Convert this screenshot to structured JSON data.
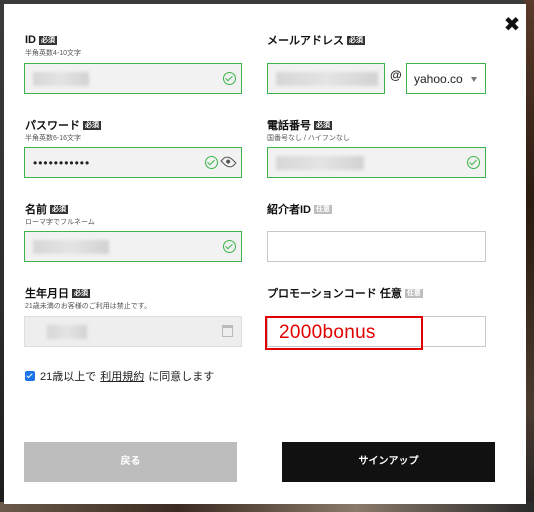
{
  "close_label": "✖",
  "fields": {
    "id": {
      "label": "ID",
      "badge": "必須",
      "hint": "半角英数4-10文字"
    },
    "email": {
      "label": "メールアドレス",
      "badge": "必須",
      "at": "@",
      "domain_selected": "yahoo.co"
    },
    "password": {
      "label": "パスワード",
      "badge": "必須",
      "hint": "半角英数6-16文字",
      "value": "•••••••••••"
    },
    "phone": {
      "label": "電話番号",
      "badge": "必須",
      "hint": "国番号なし / ハイフンなし"
    },
    "name": {
      "label": "名前",
      "badge": "必須",
      "hint": "ローマ字でフルネーム"
    },
    "referrer": {
      "label": "紹介者ID",
      "badge": "任意"
    },
    "birthdate": {
      "label": "生年月日",
      "badge": "必須",
      "hint": "21歳未満のお客様のご利用は禁止です。"
    },
    "promo": {
      "label": "プロモーションコード 任意",
      "badge": "任意",
      "value": "2000bonus"
    }
  },
  "agree": {
    "prefix": "21歳以上で",
    "link": "利用規約",
    "suffix": "に同意します",
    "checked": true
  },
  "buttons": {
    "back": "戻る",
    "signup": "サインアップ"
  },
  "colors": {
    "valid": "#3ab54a",
    "highlight": "#e00000",
    "checkbox": "#1a73e8"
  }
}
